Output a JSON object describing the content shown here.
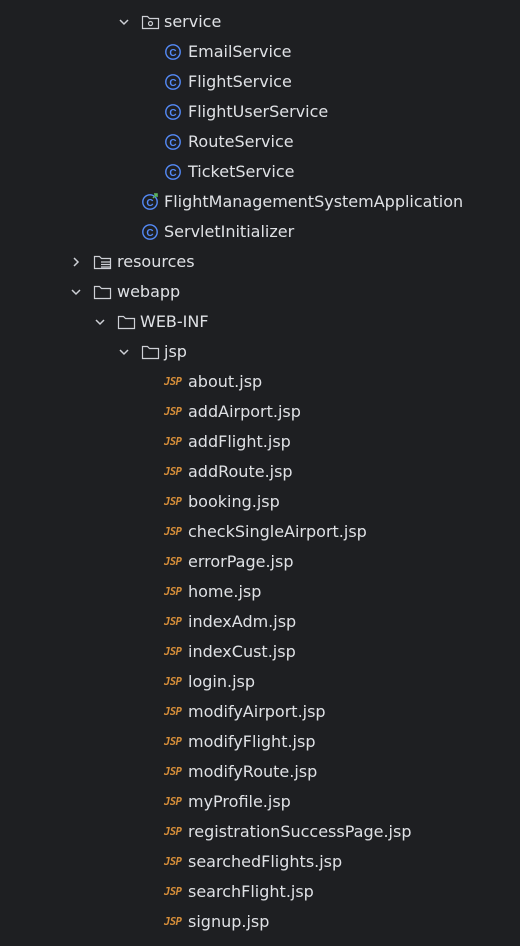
{
  "tree": {
    "service_folder": "service",
    "service_classes": [
      "EmailService",
      "FlightService",
      "FlightUserService",
      "RouteService",
      "TicketService"
    ],
    "app_class": "FlightManagementSystemApplication",
    "servlet_class": "ServletInitializer",
    "resources_folder": "resources",
    "webapp_folder": "webapp",
    "webinf_folder": "WEB-INF",
    "jsp_folder": "jsp",
    "jsp_icon_text": "JSP",
    "jsp_files": [
      "about.jsp",
      "addAirport.jsp",
      "addFlight.jsp",
      "addRoute.jsp",
      "booking.jsp",
      "checkSingleAirport.jsp",
      "errorPage.jsp",
      "home.jsp",
      "indexAdm.jsp",
      "indexCust.jsp",
      "login.jsp",
      "modifyAirport.jsp",
      "modifyFlight.jsp",
      "modifyRoute.jsp",
      "myProfile.jsp",
      "registrationSuccessPage.jsp",
      "searchedFlights.jsp",
      "searchFlight.jsp",
      "signup.jsp"
    ]
  },
  "colors": {
    "background": "#1e1f22",
    "text": "#dfe1e5",
    "class_icon": "#548af7",
    "jsp_icon": "#d88f3a",
    "icon_stroke": "#ced0d6"
  }
}
